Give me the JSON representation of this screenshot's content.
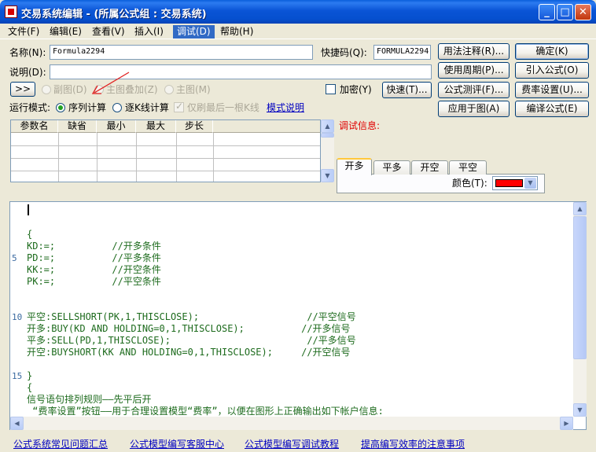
{
  "window": {
    "title": "交易系统编辑 - (所属公式组 : 交易系统)"
  },
  "menu": [
    "文件(F)",
    "编辑(E)",
    "查看(V)",
    "插入(I)",
    "调试(D)",
    "帮助(H)"
  ],
  "form": {
    "name_label": "名称(N):",
    "name_value": "Formula2294",
    "shortcut_label": "快捷码(Q):",
    "shortcut_value": "FORMULA2294",
    "desc_label": "说明(D):",
    "desc_value": ""
  },
  "options": {
    "expand_btn": ">>",
    "subchart": "副图(D)",
    "overlay": "主图叠加(Z)",
    "mainchart": "主图(M)",
    "encrypt": "加密(Y)",
    "quick_btn": "快速(T)...",
    "mode_label": "运行模式:",
    "mode_sequence": "序列计算",
    "mode_kline": "逐K线计算",
    "only_last": "仅刷最后一根K线",
    "mode_help": "模式说明"
  },
  "buttons": {
    "syntax": "用法注释(R)...",
    "ok": "确定(K)",
    "period": "使用周期(P)...",
    "import": "引入公式(O)",
    "test": "公式测评(F)...",
    "fee": "费率设置(U)...",
    "apply": "应用于图(A)",
    "compile": "编译公式(E)"
  },
  "param_table": {
    "headers": [
      "参数名",
      "缺省",
      "最小",
      "最大",
      "步长"
    ]
  },
  "debug": {
    "label": "调试信息:",
    "tabs": [
      "开多",
      "平多",
      "开空",
      "平空"
    ],
    "color_label": "颜色(T):",
    "color_value": "#FF0000"
  },
  "editor": {
    "lines": [
      {
        "no": "",
        "text": ""
      },
      {
        "no": "",
        "text": ""
      },
      {
        "no": "",
        "text": "{"
      },
      {
        "no": "",
        "text": "KD:=;          //开多条件"
      },
      {
        "no": "5",
        "text": "PD:=;          //平多条件"
      },
      {
        "no": "",
        "text": "KK:=;          //开空条件"
      },
      {
        "no": "",
        "text": "PK:=;          //平空条件"
      },
      {
        "no": "",
        "text": ""
      },
      {
        "no": "",
        "text": ""
      },
      {
        "no": "10",
        "text": "平空:SELLSHORT(PK,1,THISCLOSE);                   //平空信号"
      },
      {
        "no": "",
        "text": "开多:BUY(KD AND HOLDING=0,1,THISCLOSE);          //开多信号"
      },
      {
        "no": "",
        "text": "平多:SELL(PD,1,THISCLOSE);                        //平多信号"
      },
      {
        "no": "",
        "text": "开空:BUYSHORT(KK AND HOLDING=0,1,THISCLOSE);     //开空信号"
      },
      {
        "no": "",
        "text": ""
      },
      {
        "no": "15",
        "text": "}"
      },
      {
        "no": "",
        "text": "{"
      },
      {
        "no": "",
        "text": "信号语句排列规则——先平后开"
      },
      {
        "no": "",
        "text": " “费率设置”按钮——用于合理设置模型“费率”，以便在图形上正确输出如下帐户信息:"
      }
    ]
  },
  "footer": [
    "公式系统常见问题汇总",
    "公式模型编写客服中心",
    "公式模型编写调试教程",
    "提高编写效率的注意事项"
  ]
}
